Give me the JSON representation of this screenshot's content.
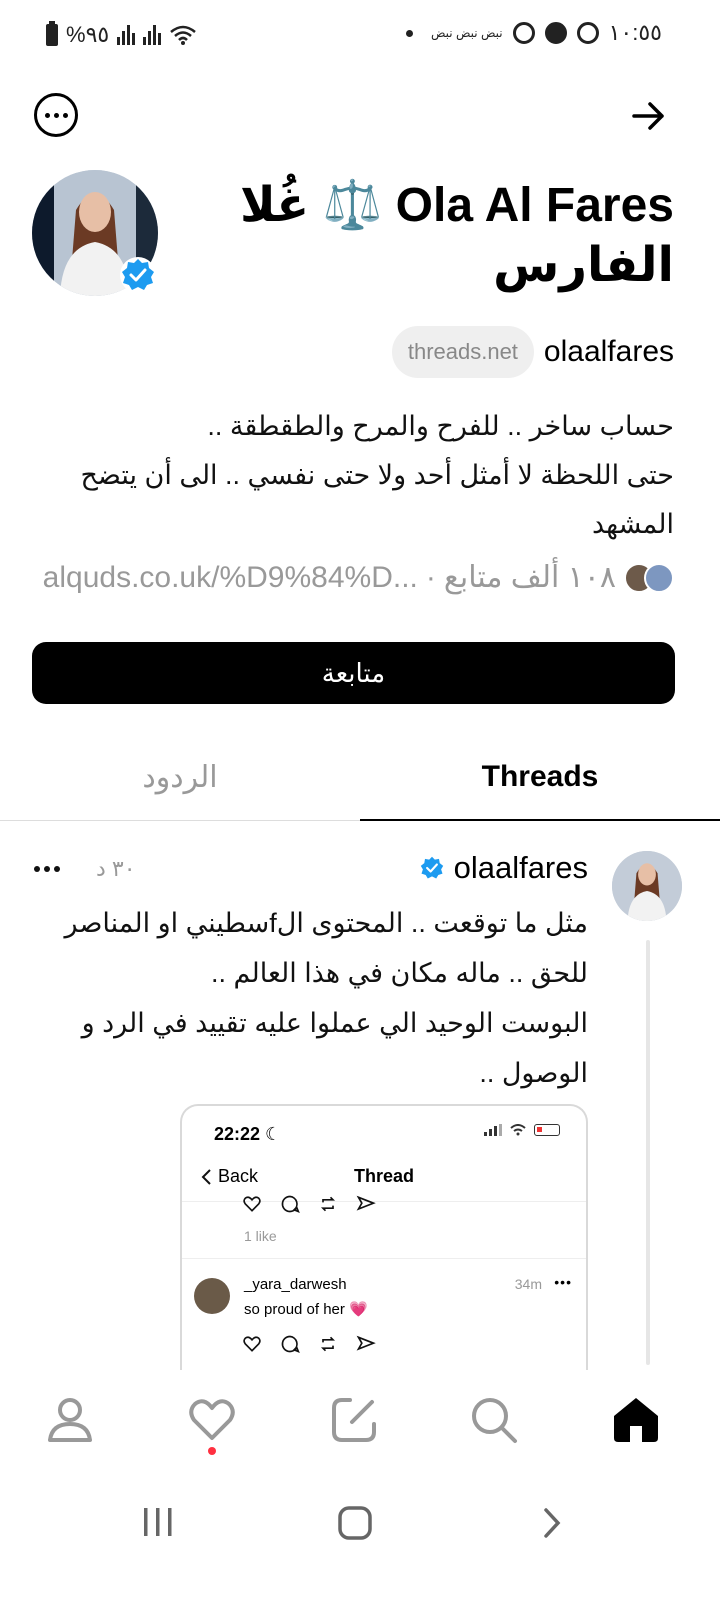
{
  "status_bar": {
    "time": "١٠:٥٥",
    "battery": "%٩٥",
    "notifications": "نبض نبض نبض"
  },
  "header": {
    "menu_icon": "more-horizontal-icon",
    "back_icon": "arrow-right-icon"
  },
  "profile": {
    "display_name": "Ola Al Fares ⚖️ غُلا الفارس",
    "handle": "olaalfares",
    "domain_badge": "threads.net",
    "bio_lines": [
      "حساب ساخر .. للفرح والمرح والطقطقة ..",
      "حتى اللحظة لا أمثل أحد ولا حتى نفسي  .. الى أن يتضح",
      "المشهد"
    ],
    "followers": "١٠٨ ألف متابع",
    "separator": "·",
    "link": "alquds.co.uk/%D9%84%D...",
    "follow_button": "متابعة"
  },
  "tabs": [
    {
      "label": "Threads",
      "active": true
    },
    {
      "label": "الردود",
      "active": false
    }
  ],
  "post": {
    "author": "olaalfares",
    "time": "٣٠ د",
    "text_lines": [
      "مثل ما توقعت .. المحتوى الfسطيني  او المناصر",
      "للحق .. ماله مكان في هذا العالم ..",
      "البوست الوحيد الي عملوا عليه تقييد في الرد و",
      "الوصول .."
    ],
    "embed": {
      "time": "22:22",
      "back_label": "Back",
      "title": "Thread",
      "likes": "1 like",
      "comment_user": "_yara_darwesh",
      "comment_time": "34m",
      "comment_text": "so proud of her",
      "comment_emoji": "💗"
    }
  },
  "bottom_nav": [
    "profile-icon",
    "heart-icon",
    "compose-icon",
    "search-icon",
    "home-icon"
  ],
  "system_nav": [
    "recents-icon",
    "home-circle-icon",
    "back-chevron-icon"
  ]
}
